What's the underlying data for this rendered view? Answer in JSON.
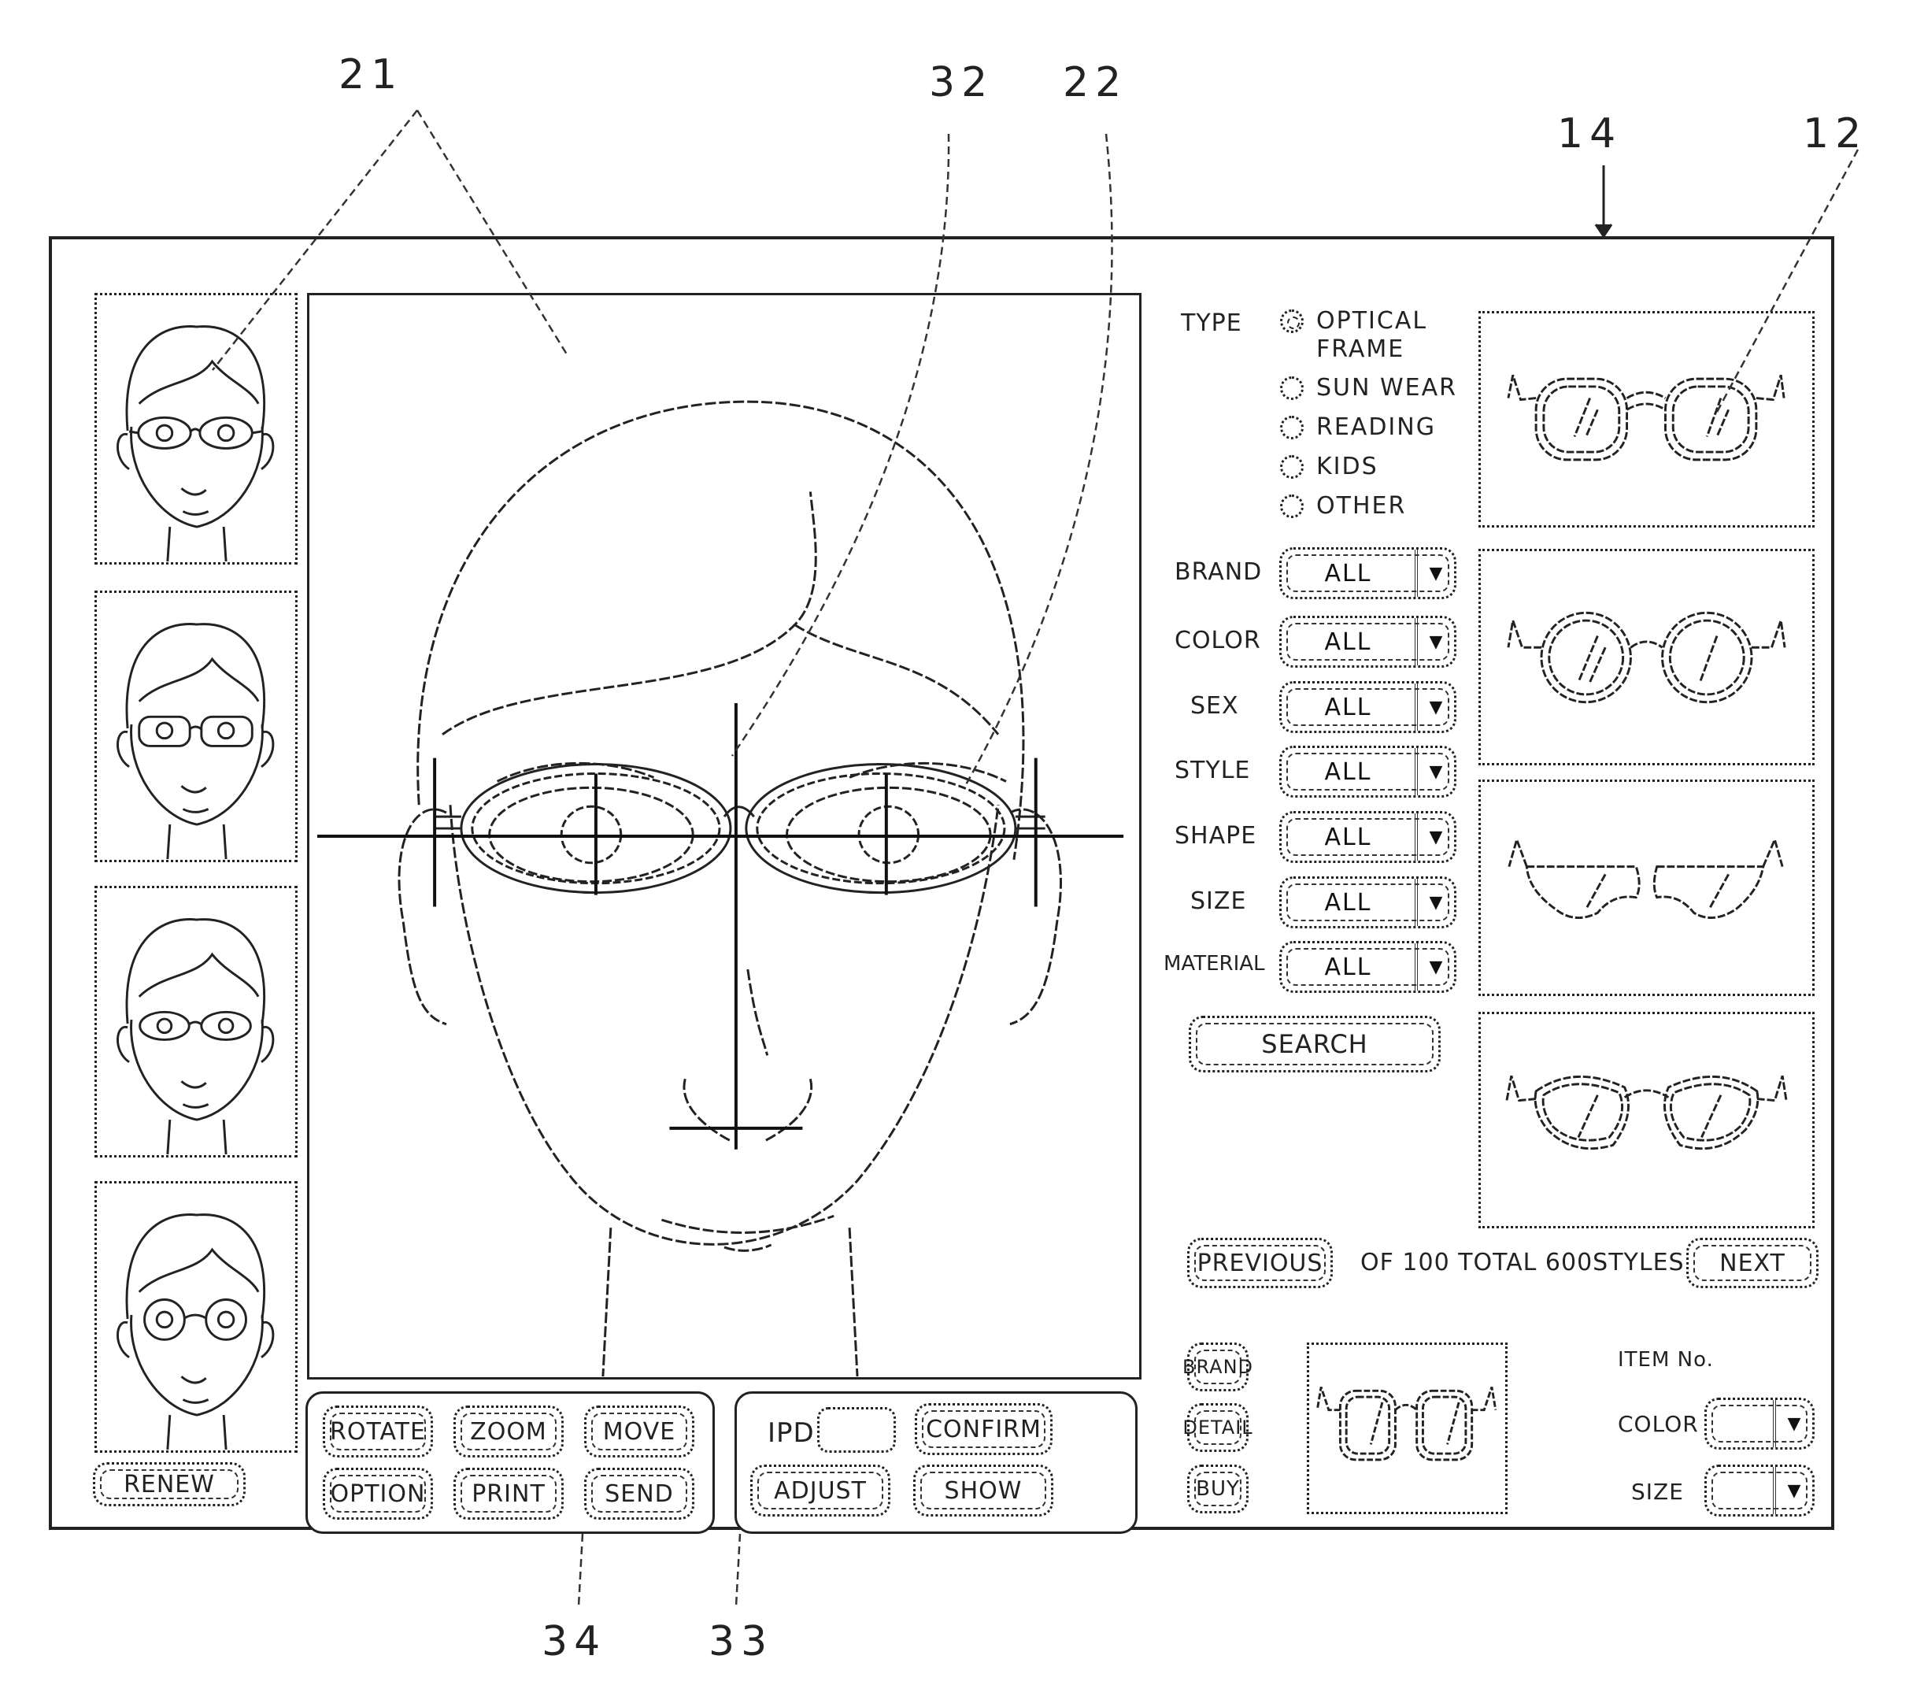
{
  "reference_numerals": {
    "faces": "21",
    "midline": "32",
    "frame": "22",
    "screen": "14",
    "product": "12",
    "panel_left": "34",
    "panel_right": "33"
  },
  "left_sidebar": {
    "face_thumbnails": [
      {
        "label": "face-thumbnail-1"
      },
      {
        "label": "face-thumbnail-2"
      },
      {
        "label": "face-thumbnail-3"
      },
      {
        "label": "face-thumbnail-4"
      }
    ],
    "renew_label": "RENEW"
  },
  "view_controls": {
    "rotate": "ROTATE",
    "zoom": "ZOOM",
    "move": "MOVE",
    "option": "OPTION",
    "print": "PRINT",
    "send": "SEND"
  },
  "fit_controls": {
    "ipd_label": "IPD",
    "ipd_value": "",
    "confirm": "CONFIRM",
    "adjust": "ADJUST",
    "show": "SHOW"
  },
  "filters": {
    "type_label": "TYPE",
    "type_options": [
      {
        "label": "OPTICAL",
        "label2": "FRAME",
        "selected": true
      },
      {
        "label": "SUN WEAR",
        "selected": false
      },
      {
        "label": "READING",
        "selected": false
      },
      {
        "label": "KIDS",
        "selected": false
      },
      {
        "label": "OTHER",
        "selected": false
      }
    ],
    "dropdowns": [
      {
        "label": "BRAND",
        "value": "ALL"
      },
      {
        "label": "COLOR",
        "value": "ALL"
      },
      {
        "label": "SEX",
        "value": "ALL"
      },
      {
        "label": "STYLE",
        "value": "ALL"
      },
      {
        "label": "SHAPE",
        "value": "ALL"
      },
      {
        "label": "SIZE",
        "value": "ALL"
      },
      {
        "label": "MATERIAL",
        "value": "ALL"
      }
    ],
    "arrow_glyph": "▼",
    "search_label": "SEARCH"
  },
  "results": {
    "products": [
      {
        "style": "square-optical"
      },
      {
        "style": "round-optical"
      },
      {
        "style": "sport-sunglasses"
      },
      {
        "style": "cat-eye"
      }
    ],
    "previous_label": "PREVIOUS",
    "pagination_text": "OF 100 TOTAL 600STYLES",
    "next_label": "NEXT"
  },
  "selected_item": {
    "brand_label": "BRAND",
    "detail_label": "DETAIL",
    "buy_label": "BUY",
    "item_no_label": "ITEM No.",
    "color_label": "COLOR",
    "color_value": "",
    "size_label": "SIZE",
    "size_value": "",
    "arrow_glyph": "▼"
  }
}
